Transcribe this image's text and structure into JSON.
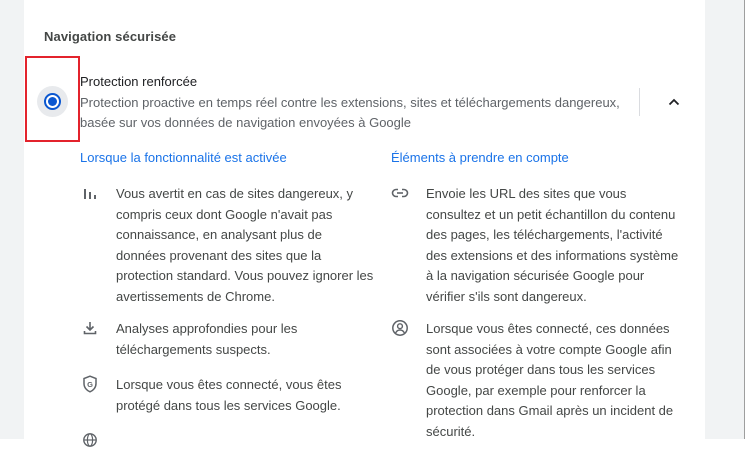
{
  "section": {
    "title": "Navigation sécurisée"
  },
  "option": {
    "title": "Protection renforcée",
    "description": "Protection proactive en temps réel contre les extensions, sites et téléchargements dangereux, basée sur vos données de navigation envoyées à Google",
    "selected": true,
    "expanded": true
  },
  "columns": {
    "left": {
      "heading": "Lorsque la fonctionnalité est activée",
      "items": [
        {
          "icon": "bar-chart-icon",
          "text": "Vous avertit en cas de sites dangereux, y compris ceux dont Google n'avait pas connaissance, en analysant plus de données provenant des sites que la protection standard. Vous pouvez ignorer les avertissements de Chrome."
        },
        {
          "icon": "download-icon",
          "text": "Analyses approfondies pour les téléchargements suspects."
        },
        {
          "icon": "google-shield-icon",
          "text": "Lorsque vous êtes connecté, vous êtes protégé dans tous les services Google."
        },
        {
          "icon": "globe-icon",
          "text": ""
        }
      ]
    },
    "right": {
      "heading": "Éléments à prendre en compte",
      "items": [
        {
          "icon": "link-icon",
          "text": "Envoie les URL des sites que vous consultez et un petit échantillon du contenu des pages, les téléchargements, l'activité des extensions et des informations système à la navigation sécurisée Google pour vérifier s'ils sont dangereux."
        },
        {
          "icon": "account-circle-icon",
          "text": "Lorsque vous êtes connecté, ces données sont associées à votre compte Google afin de vous protéger dans tous les services Google, par exemple pour renforcer la protection dans Gmail après un incident de sécurité."
        }
      ]
    }
  },
  "colors": {
    "accent": "#0b57d0",
    "link": "#1a73e8",
    "highlight_box": "#e3232c"
  }
}
